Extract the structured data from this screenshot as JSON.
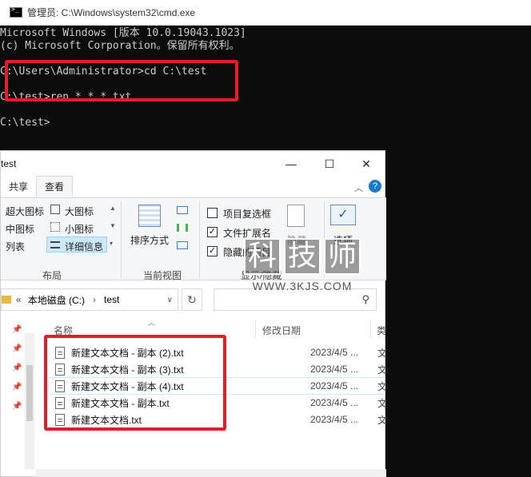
{
  "cmd": {
    "title": "管理员: C:\\Windows\\system32\\cmd.exe",
    "lines": [
      "Microsoft Windows [版本 10.0.19043.1023]",
      "(c) Microsoft Corporation。保留所有权利。",
      "C:\\Users\\Administrator>cd C:\\test",
      "C:\\test>ren *.* *.txt",
      "C:\\test>"
    ]
  },
  "explorer": {
    "title": "test",
    "controls": {
      "minimize": "—",
      "maximize": "☐",
      "close": "✕"
    },
    "tabs": [
      "共享",
      "查看"
    ],
    "ribbon": {
      "layout": {
        "extra_large": "超大图标",
        "large": "大图标",
        "medium": "中图标",
        "small": "小图标",
        "list": "列表",
        "details": "详细信息",
        "label": "布局"
      },
      "current_view": {
        "sort": "排序方式",
        "label": "当前视图"
      },
      "show_hide": {
        "item_checkboxes": "项目复选框",
        "file_extensions": "文件扩展名",
        "hidden_items": "隐藏的项目",
        "hide": "隐藏",
        "label": "显示/隐藏",
        "options": "选项"
      }
    },
    "address": {
      "prefix": "«",
      "drive": "本地磁盘 (C:)",
      "arrow": "›",
      "folder": "test"
    },
    "columns": {
      "name": "名称",
      "modified": "修改日期",
      "type": "类"
    },
    "files": [
      {
        "name": "新建文本文档 - 副本 (2).txt",
        "date": "2023/4/5 ...",
        "type": "文"
      },
      {
        "name": "新建文本文档 - 副本 (3).txt",
        "date": "2023/4/5 ...",
        "type": "文"
      },
      {
        "name": "新建文本文档 - 副本 (4).txt",
        "date": "2023/4/5 ...",
        "type": "文"
      },
      {
        "name": "新建文本文档 - 副本.txt",
        "date": "2023/4/5 ...",
        "type": "文"
      },
      {
        "name": "新建文本文档.txt",
        "date": "2023/4/5 ...",
        "type": "文"
      }
    ]
  },
  "watermark": {
    "chars": [
      "科",
      "技",
      "师"
    ],
    "url": "WWW.3KJS.COM"
  },
  "colors": {
    "highlight": "#e21e2a",
    "cmd_bg": "#0c0c0c"
  }
}
